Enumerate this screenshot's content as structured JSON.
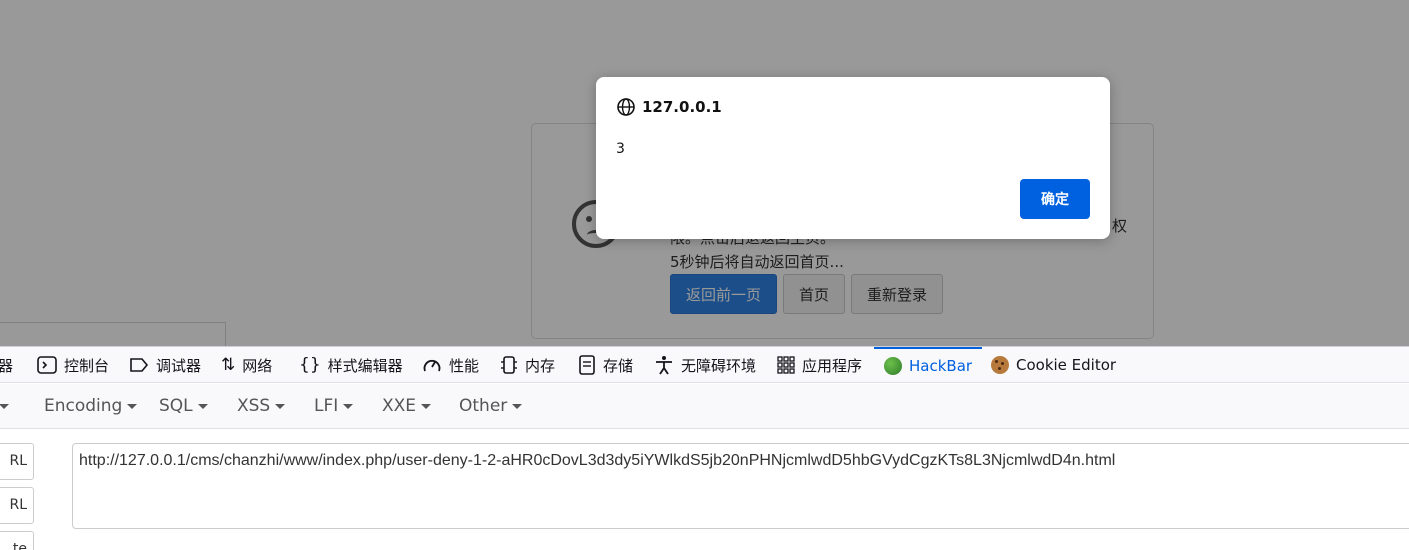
{
  "page": {
    "deny_message_line1_tail": "权",
    "deny_message_line2": "限。点击后退返回主页。",
    "deny_message_line3": "5秒钟后将自动返回首页...",
    "buttons": {
      "back": "返回前一页",
      "home": "首页",
      "relogin": "重新登录"
    }
  },
  "dialog": {
    "origin": "127.0.0.1",
    "message": "3",
    "ok_label": "确定",
    "ok_color": "#0061e0"
  },
  "devtools": {
    "tabs": [
      {
        "label": "器",
        "icon": "inspector-icon"
      },
      {
        "label": "控制台",
        "icon": "console-icon"
      },
      {
        "label": "调试器",
        "icon": "debugger-icon"
      },
      {
        "label": "网络",
        "icon": "network-icon"
      },
      {
        "label": "样式编辑器",
        "icon": "style-editor-icon"
      },
      {
        "label": "性能",
        "icon": "performance-icon"
      },
      {
        "label": "内存",
        "icon": "memory-icon"
      },
      {
        "label": "存储",
        "icon": "storage-icon"
      },
      {
        "label": "无障碍环境",
        "icon": "accessibility-icon"
      },
      {
        "label": "应用程序",
        "icon": "application-icon"
      },
      {
        "label": "HackBar",
        "icon": "hackbar-icon",
        "active": true
      },
      {
        "label": "Cookie Editor",
        "icon": "cookie-icon"
      }
    ],
    "active_color": "#0060df",
    "hackbar_menu": [
      "Encoding",
      "SQL",
      "XSS",
      "LFI",
      "XXE",
      "Other"
    ],
    "side_buttons": [
      "RL",
      "RL",
      "te"
    ],
    "url": "http://127.0.0.1/cms/chanzhi/www/index.php/user-deny-1-2-aHR0cDovL3d3dy5iYWlkdS5jb20nPHNjcmlwdD5hbGVydCgzKTs8L3NjcmlwdD4n.html"
  }
}
